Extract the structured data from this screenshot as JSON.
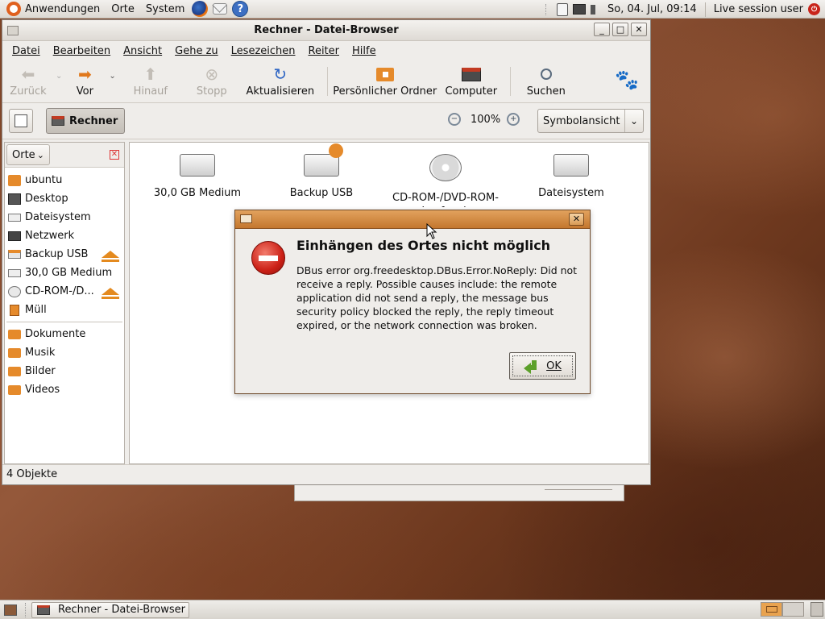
{
  "top_panel": {
    "menus": [
      "Anwendungen",
      "Orte",
      "System"
    ],
    "launchers": [
      "firefox-icon",
      "mail-icon",
      "help-icon"
    ],
    "clock": "So, 04. Jul, 09:14",
    "user": "Live session user"
  },
  "window": {
    "title": "Rechner - Datei-Browser",
    "menu": [
      "Datei",
      "Bearbeiten",
      "Ansicht",
      "Gehe zu",
      "Lesezeichen",
      "Reiter",
      "Hilfe"
    ],
    "toolbar": {
      "back": "Zurück",
      "forward": "Vor",
      "up": "Hinauf",
      "stop": "Stopp",
      "reload": "Aktualisieren",
      "home": "Persönlicher Ordner",
      "computer": "Computer",
      "search": "Suchen"
    },
    "location": {
      "path_button": "Rechner",
      "zoom": "100%",
      "view_mode": "Symbolansicht"
    },
    "sidebar": {
      "header": "Orte",
      "items": [
        "ubuntu",
        "Desktop",
        "Dateisystem",
        "Netzwerk",
        "Backup USB",
        "30,0 GB Medium",
        "CD-ROM-/D...",
        "Müll"
      ],
      "bookmarks": [
        "Dokumente",
        "Musik",
        "Bilder",
        "Videos"
      ]
    },
    "icons": [
      {
        "label": "30,0 GB Medium",
        "icon": "hard-drive-icon"
      },
      {
        "label": "Backup USB",
        "icon": "usb-drive-icon"
      },
      {
        "label": "CD-ROM-/DVD-ROM-Laufwerk",
        "icon": "optical-drive-icon"
      },
      {
        "label": "Dateisystem",
        "icon": "hard-drive-icon"
      }
    ],
    "status": "4 Objekte"
  },
  "dialog": {
    "heading": "Einhängen des Ortes nicht möglich",
    "message": "DBus error org.freedesktop.DBus.Error.NoReply: Did not receive a reply. Possible causes include: the remote application did not send a reply, the message bus security policy blocked the reply, the reply timeout expired, or the network connection was broken.",
    "ok": "OK"
  },
  "taskbar": {
    "task": "Rechner - Datei-Browser"
  }
}
